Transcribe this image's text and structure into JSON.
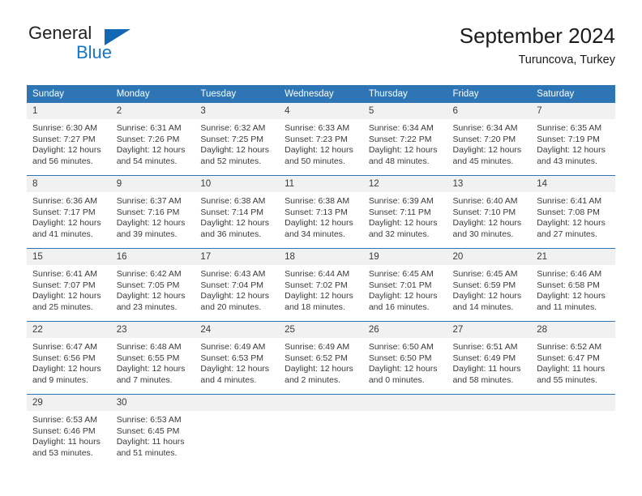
{
  "logo": {
    "word_top": "General",
    "word_bottom": "Blue",
    "triangle_color": "#1268b3",
    "blue_color": "#1577c4"
  },
  "header": {
    "title": "September 2024",
    "subtitle": "Turuncova, Turkey"
  },
  "theme": {
    "header_blue": "#2e75b6",
    "daynum_band": "#f1f1f1",
    "text": "#3a3a3a"
  },
  "labels": {
    "sunrise_prefix": "Sunrise:",
    "sunset_prefix": "Sunset:",
    "daylight_prefix": "Daylight:"
  },
  "weekdays": [
    "Sunday",
    "Monday",
    "Tuesday",
    "Wednesday",
    "Thursday",
    "Friday",
    "Saturday"
  ],
  "weeks": [
    [
      {
        "day": "1",
        "sunrise": "Sunrise: 6:30 AM",
        "sunset": "Sunset: 7:27 PM",
        "daylight_line1": "Daylight: 12 hours",
        "daylight_line2": "and 56 minutes."
      },
      {
        "day": "2",
        "sunrise": "Sunrise: 6:31 AM",
        "sunset": "Sunset: 7:26 PM",
        "daylight_line1": "Daylight: 12 hours",
        "daylight_line2": "and 54 minutes."
      },
      {
        "day": "3",
        "sunrise": "Sunrise: 6:32 AM",
        "sunset": "Sunset: 7:25 PM",
        "daylight_line1": "Daylight: 12 hours",
        "daylight_line2": "and 52 minutes."
      },
      {
        "day": "4",
        "sunrise": "Sunrise: 6:33 AM",
        "sunset": "Sunset: 7:23 PM",
        "daylight_line1": "Daylight: 12 hours",
        "daylight_line2": "and 50 minutes."
      },
      {
        "day": "5",
        "sunrise": "Sunrise: 6:34 AM",
        "sunset": "Sunset: 7:22 PM",
        "daylight_line1": "Daylight: 12 hours",
        "daylight_line2": "and 48 minutes."
      },
      {
        "day": "6",
        "sunrise": "Sunrise: 6:34 AM",
        "sunset": "Sunset: 7:20 PM",
        "daylight_line1": "Daylight: 12 hours",
        "daylight_line2": "and 45 minutes."
      },
      {
        "day": "7",
        "sunrise": "Sunrise: 6:35 AM",
        "sunset": "Sunset: 7:19 PM",
        "daylight_line1": "Daylight: 12 hours",
        "daylight_line2": "and 43 minutes."
      }
    ],
    [
      {
        "day": "8",
        "sunrise": "Sunrise: 6:36 AM",
        "sunset": "Sunset: 7:17 PM",
        "daylight_line1": "Daylight: 12 hours",
        "daylight_line2": "and 41 minutes."
      },
      {
        "day": "9",
        "sunrise": "Sunrise: 6:37 AM",
        "sunset": "Sunset: 7:16 PM",
        "daylight_line1": "Daylight: 12 hours",
        "daylight_line2": "and 39 minutes."
      },
      {
        "day": "10",
        "sunrise": "Sunrise: 6:38 AM",
        "sunset": "Sunset: 7:14 PM",
        "daylight_line1": "Daylight: 12 hours",
        "daylight_line2": "and 36 minutes."
      },
      {
        "day": "11",
        "sunrise": "Sunrise: 6:38 AM",
        "sunset": "Sunset: 7:13 PM",
        "daylight_line1": "Daylight: 12 hours",
        "daylight_line2": "and 34 minutes."
      },
      {
        "day": "12",
        "sunrise": "Sunrise: 6:39 AM",
        "sunset": "Sunset: 7:11 PM",
        "daylight_line1": "Daylight: 12 hours",
        "daylight_line2": "and 32 minutes."
      },
      {
        "day": "13",
        "sunrise": "Sunrise: 6:40 AM",
        "sunset": "Sunset: 7:10 PM",
        "daylight_line1": "Daylight: 12 hours",
        "daylight_line2": "and 30 minutes."
      },
      {
        "day": "14",
        "sunrise": "Sunrise: 6:41 AM",
        "sunset": "Sunset: 7:08 PM",
        "daylight_line1": "Daylight: 12 hours",
        "daylight_line2": "and 27 minutes."
      }
    ],
    [
      {
        "day": "15",
        "sunrise": "Sunrise: 6:41 AM",
        "sunset": "Sunset: 7:07 PM",
        "daylight_line1": "Daylight: 12 hours",
        "daylight_line2": "and 25 minutes."
      },
      {
        "day": "16",
        "sunrise": "Sunrise: 6:42 AM",
        "sunset": "Sunset: 7:05 PM",
        "daylight_line1": "Daylight: 12 hours",
        "daylight_line2": "and 23 minutes."
      },
      {
        "day": "17",
        "sunrise": "Sunrise: 6:43 AM",
        "sunset": "Sunset: 7:04 PM",
        "daylight_line1": "Daylight: 12 hours",
        "daylight_line2": "and 20 minutes."
      },
      {
        "day": "18",
        "sunrise": "Sunrise: 6:44 AM",
        "sunset": "Sunset: 7:02 PM",
        "daylight_line1": "Daylight: 12 hours",
        "daylight_line2": "and 18 minutes."
      },
      {
        "day": "19",
        "sunrise": "Sunrise: 6:45 AM",
        "sunset": "Sunset: 7:01 PM",
        "daylight_line1": "Daylight: 12 hours",
        "daylight_line2": "and 16 minutes."
      },
      {
        "day": "20",
        "sunrise": "Sunrise: 6:45 AM",
        "sunset": "Sunset: 6:59 PM",
        "daylight_line1": "Daylight: 12 hours",
        "daylight_line2": "and 14 minutes."
      },
      {
        "day": "21",
        "sunrise": "Sunrise: 6:46 AM",
        "sunset": "Sunset: 6:58 PM",
        "daylight_line1": "Daylight: 12 hours",
        "daylight_line2": "and 11 minutes."
      }
    ],
    [
      {
        "day": "22",
        "sunrise": "Sunrise: 6:47 AM",
        "sunset": "Sunset: 6:56 PM",
        "daylight_line1": "Daylight: 12 hours",
        "daylight_line2": "and 9 minutes."
      },
      {
        "day": "23",
        "sunrise": "Sunrise: 6:48 AM",
        "sunset": "Sunset: 6:55 PM",
        "daylight_line1": "Daylight: 12 hours",
        "daylight_line2": "and 7 minutes."
      },
      {
        "day": "24",
        "sunrise": "Sunrise: 6:49 AM",
        "sunset": "Sunset: 6:53 PM",
        "daylight_line1": "Daylight: 12 hours",
        "daylight_line2": "and 4 minutes."
      },
      {
        "day": "25",
        "sunrise": "Sunrise: 6:49 AM",
        "sunset": "Sunset: 6:52 PM",
        "daylight_line1": "Daylight: 12 hours",
        "daylight_line2": "and 2 minutes."
      },
      {
        "day": "26",
        "sunrise": "Sunrise: 6:50 AM",
        "sunset": "Sunset: 6:50 PM",
        "daylight_line1": "Daylight: 12 hours",
        "daylight_line2": "and 0 minutes."
      },
      {
        "day": "27",
        "sunrise": "Sunrise: 6:51 AM",
        "sunset": "Sunset: 6:49 PM",
        "daylight_line1": "Daylight: 11 hours",
        "daylight_line2": "and 58 minutes."
      },
      {
        "day": "28",
        "sunrise": "Sunrise: 6:52 AM",
        "sunset": "Sunset: 6:47 PM",
        "daylight_line1": "Daylight: 11 hours",
        "daylight_line2": "and 55 minutes."
      }
    ],
    [
      {
        "day": "29",
        "sunrise": "Sunrise: 6:53 AM",
        "sunset": "Sunset: 6:46 PM",
        "daylight_line1": "Daylight: 11 hours",
        "daylight_line2": "and 53 minutes."
      },
      {
        "day": "30",
        "sunrise": "Sunrise: 6:53 AM",
        "sunset": "Sunset: 6:45 PM",
        "daylight_line1": "Daylight: 11 hours",
        "daylight_line2": "and 51 minutes."
      },
      {
        "day": "",
        "sunrise": "",
        "sunset": "",
        "daylight_line1": "",
        "daylight_line2": ""
      },
      {
        "day": "",
        "sunrise": "",
        "sunset": "",
        "daylight_line1": "",
        "daylight_line2": ""
      },
      {
        "day": "",
        "sunrise": "",
        "sunset": "",
        "daylight_line1": "",
        "daylight_line2": ""
      },
      {
        "day": "",
        "sunrise": "",
        "sunset": "",
        "daylight_line1": "",
        "daylight_line2": ""
      },
      {
        "day": "",
        "sunrise": "",
        "sunset": "",
        "daylight_line1": "",
        "daylight_line2": ""
      }
    ]
  ]
}
